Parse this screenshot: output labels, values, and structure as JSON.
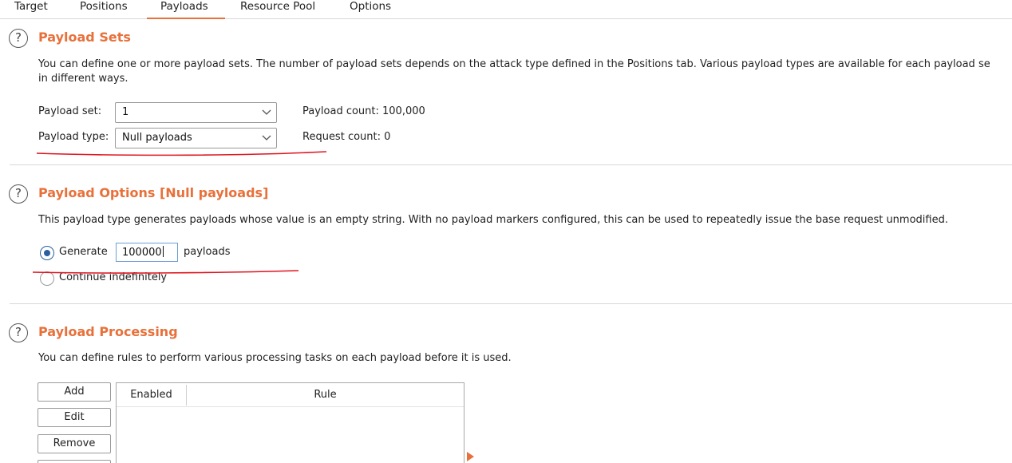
{
  "tabs": [
    {
      "label": "Target",
      "active": false
    },
    {
      "label": "Positions",
      "active": false
    },
    {
      "label": "Payloads",
      "active": true
    },
    {
      "label": "Resource Pool",
      "active": false
    },
    {
      "label": "Options",
      "active": false
    }
  ],
  "help_glyph": "?",
  "payload_sets": {
    "title": "Payload Sets",
    "desc_line1": "You can define one or more payload sets. The number of payload sets depends on the attack type defined in the Positions tab. Various payload types are available for each payload se",
    "desc_line2": "in different ways.",
    "set_label": "Payload set:",
    "set_value": "1",
    "type_label": "Payload type:",
    "type_value": "Null payloads",
    "payload_count": "Payload count: 100,000",
    "request_count": "Request count: 0"
  },
  "payload_options": {
    "title": "Payload Options [Null payloads]",
    "desc": "This payload type generates payloads whose value is an empty string. With no payload markers configured, this can be used to repeatedly issue the base request unmodified.",
    "generate_label": "Generate",
    "generate_value": "100000",
    "payloads_suffix": "payloads",
    "continue_label": "Continue indefinitely",
    "selected": "generate"
  },
  "payload_processing": {
    "title": "Payload Processing",
    "desc": "You can define rules to perform various processing tasks on each payload before it is used.",
    "buttons": {
      "add": "Add",
      "edit": "Edit",
      "remove": "Remove"
    },
    "columns": {
      "enabled": "Enabled",
      "rule": "Rule"
    }
  },
  "colors": {
    "accent": "#e8703a",
    "annotation": "#e0141e",
    "radio": "#2b5f9e"
  }
}
